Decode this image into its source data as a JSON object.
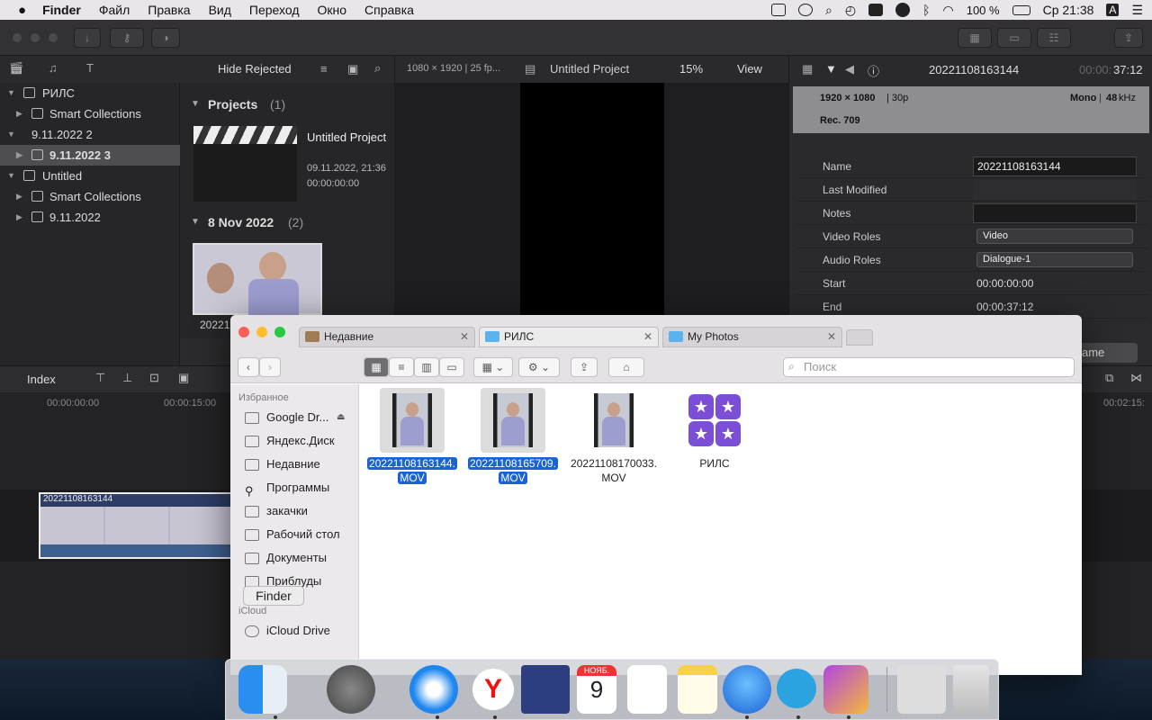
{
  "menubar": {
    "apple": "",
    "app": "Finder",
    "menus": [
      "Файл",
      "Правка",
      "Вид",
      "Переход",
      "Окно",
      "Справка"
    ],
    "battery": "100 %",
    "clock": "Ср 21:38",
    "input": "A"
  },
  "fcp": {
    "library_toolbar": {
      "hide_rejected": "Hide Rejected"
    },
    "libraries": [
      {
        "label": "РИЛС",
        "type": "library"
      },
      {
        "label": "Smart Collections",
        "type": "folder"
      },
      {
        "label": "9.11.2022 2",
        "type": "library"
      },
      {
        "label": "9.11.2022 3",
        "type": "event",
        "selected": true
      },
      {
        "label": "Untitled",
        "type": "library"
      },
      {
        "label": "Smart Collections",
        "type": "folder"
      },
      {
        "label": "9.11.2022",
        "type": "event"
      }
    ],
    "browser": {
      "group1": {
        "title": "Projects",
        "count": "(1)"
      },
      "project": {
        "name": "Untitled Project",
        "date": "09.11.2022, 21:36",
        "duration": "00:00:00:00"
      },
      "group2": {
        "title": "8 Nov 2022",
        "count": "(2)"
      },
      "clip_label": "20221"
    },
    "viewer": {
      "format": "1080 × 1920 | 25 fp...",
      "title": "Untitled Project",
      "zoom": "15%",
      "view": "View"
    },
    "inspector": {
      "clip_name": "20221108163144",
      "timecode_dim": "00:00:",
      "timecode": "37:12",
      "res": "1920 × 1080",
      "fps": "| 30p",
      "audio": "Mono",
      "rate": "48",
      "rate_unit": "kHz",
      "color": "Rec. 709",
      "rows": [
        {
          "label": "Name",
          "value": "20221108163144"
        },
        {
          "label": "Last Modified",
          "value": ""
        },
        {
          "label": "Notes",
          "value": ""
        },
        {
          "label": "Video Roles",
          "value": "Video"
        },
        {
          "label": "Audio Roles",
          "value": "Dialogue-1"
        },
        {
          "label": "Start",
          "value": "00:00:00:00"
        },
        {
          "label": "End",
          "value": "00:00:37:12"
        }
      ],
      "partial_button": "ame"
    },
    "timeline": {
      "index": "Index",
      "tc1": "00:00:00:00",
      "tc2": "00:00:15:00",
      "tc3": "00:02:15:",
      "clip": "20221108163144"
    }
  },
  "finder": {
    "tabs": [
      {
        "label": "Недавние",
        "active": false
      },
      {
        "label": "РИЛС",
        "active": true
      },
      {
        "label": "My Photos",
        "active": false
      }
    ],
    "search_placeholder": "Поиск",
    "sidebar": {
      "favorites_header": "Избранное",
      "items": [
        "Google Dr...",
        "Яндекс.Диск",
        "Недавние",
        "Программы",
        "закачки",
        "Рабочий стол",
        "Документы",
        "Приблуды"
      ],
      "icloud_header": "iCloud",
      "icloud_items": [
        "iCloud Drive"
      ]
    },
    "files": [
      {
        "line1": "20221108163144.",
        "line2": "MOV",
        "selected": true
      },
      {
        "line1": "20221108165709.",
        "line2": "MOV",
        "selected": true
      },
      {
        "line1": "20221108170033.",
        "line2": "MOV",
        "selected": false
      },
      {
        "line1": "РИЛС",
        "line2": "",
        "selected": false
      }
    ]
  },
  "dock": {
    "tooltip": "Finder",
    "calendar_month": "НОЯБ.",
    "calendar_day": "9",
    "apps": [
      "Finder",
      "Launchpad",
      "Safari",
      "Yandex",
      "Screen App",
      "Calendar",
      "Reminders",
      "Notes",
      "Yandex Disk",
      "Telegram",
      "Final Cut Pro",
      "Downloads",
      "Trash"
    ]
  },
  "colors": {
    "selection": "#1a63d6",
    "menubar": "#e8e6ea"
  }
}
